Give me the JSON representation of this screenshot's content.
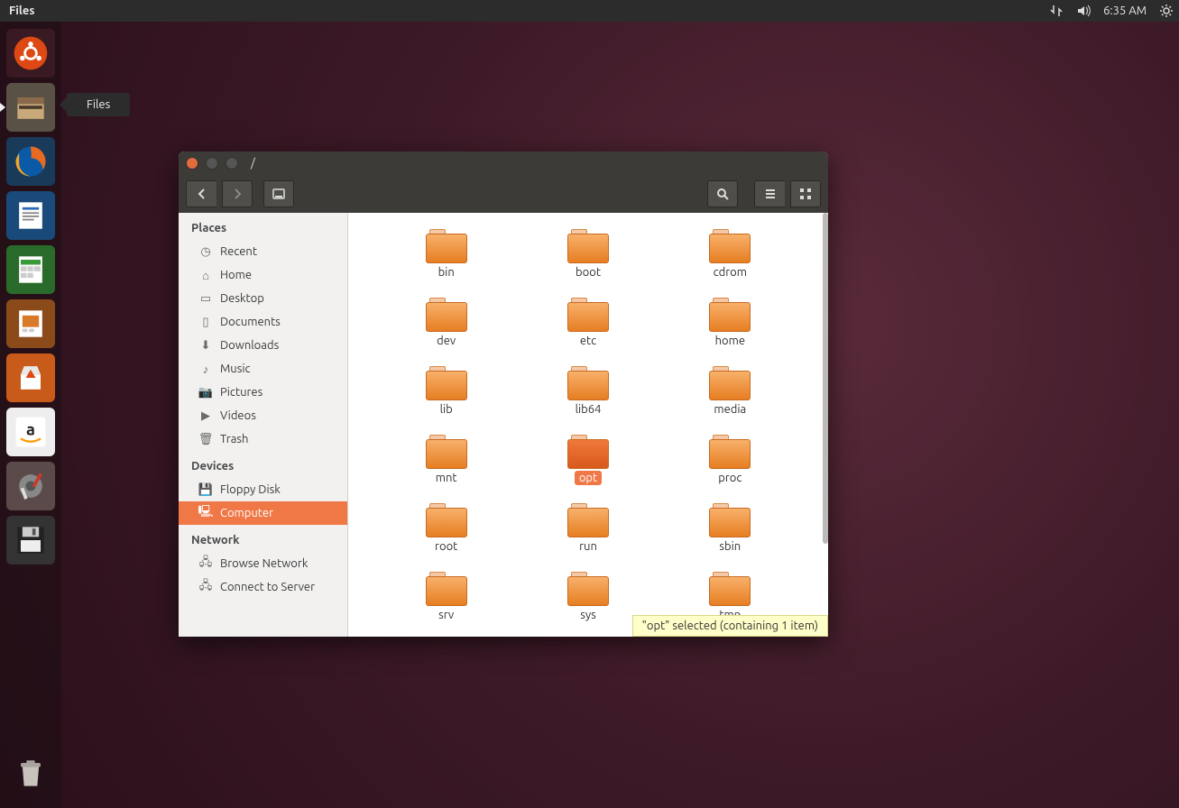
{
  "topbar": {
    "app_name": "Files",
    "time": "6:35 AM"
  },
  "launcher_tooltip": "Files",
  "window": {
    "title": "/"
  },
  "sidebar": {
    "sections": [
      {
        "heading": "Places",
        "items": [
          {
            "icon": "clock-icon",
            "label": "Recent"
          },
          {
            "icon": "home-icon",
            "label": "Home"
          },
          {
            "icon": "desktop-icon",
            "label": "Desktop"
          },
          {
            "icon": "document-icon",
            "label": "Documents"
          },
          {
            "icon": "download-icon",
            "label": "Downloads"
          },
          {
            "icon": "music-icon",
            "label": "Music"
          },
          {
            "icon": "camera-icon",
            "label": "Pictures"
          },
          {
            "icon": "video-icon",
            "label": "Videos"
          },
          {
            "icon": "trash-icon",
            "label": "Trash"
          }
        ]
      },
      {
        "heading": "Devices",
        "items": [
          {
            "icon": "floppy-icon",
            "label": "Floppy Disk"
          },
          {
            "icon": "computer-icon",
            "label": "Computer",
            "selected": true
          }
        ]
      },
      {
        "heading": "Network",
        "items": [
          {
            "icon": "network-icon",
            "label": "Browse Network"
          },
          {
            "icon": "server-icon",
            "label": "Connect to Server"
          }
        ]
      }
    ]
  },
  "folders": [
    {
      "name": "bin"
    },
    {
      "name": "boot"
    },
    {
      "name": "cdrom"
    },
    {
      "name": "dev"
    },
    {
      "name": "etc"
    },
    {
      "name": "home"
    },
    {
      "name": "lib"
    },
    {
      "name": "lib64"
    },
    {
      "name": "media"
    },
    {
      "name": "mnt"
    },
    {
      "name": "opt",
      "selected": true
    },
    {
      "name": "proc"
    },
    {
      "name": "root"
    },
    {
      "name": "run"
    },
    {
      "name": "sbin"
    },
    {
      "name": "srv"
    },
    {
      "name": "sys"
    },
    {
      "name": "tmp"
    }
  ],
  "status": "\"opt\" selected  (containing 1 item)",
  "icon_glyphs": {
    "clock-icon": "◷",
    "home-icon": "⌂",
    "desktop-icon": "▭",
    "document-icon": "▯",
    "download-icon": "⬇",
    "music-icon": "♪",
    "camera-icon": "📷",
    "video-icon": "▶",
    "trash-icon": "🗑",
    "floppy-icon": "💾",
    "computer-icon": "🖳",
    "network-icon": "🖧",
    "server-icon": "🖧"
  }
}
